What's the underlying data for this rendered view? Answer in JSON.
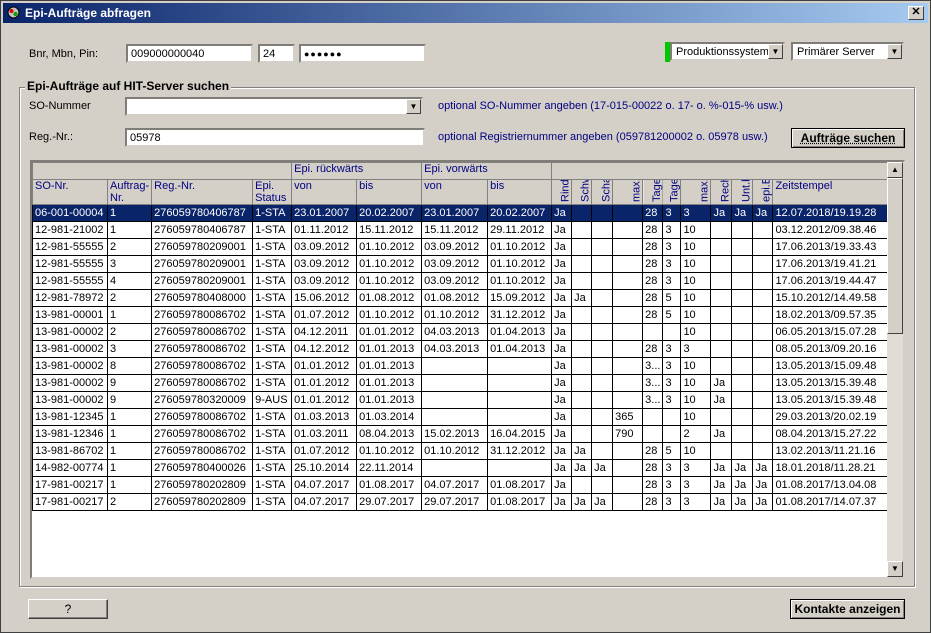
{
  "window": {
    "title": "Epi-Aufträge abfragen",
    "close_glyph": "✕"
  },
  "login": {
    "label": "Bnr, Mbn, Pin:",
    "bnr": "009000000040",
    "mbn": "24",
    "pin": "●●●●●●"
  },
  "system_select": {
    "value": "Produktionssystem"
  },
  "server_select": {
    "value": "Primärer Server"
  },
  "search_group": {
    "title": "Epi-Aufträge auf HIT-Server suchen",
    "so_label": "SO-Nummer",
    "so_value": "",
    "so_hint": "optional SO-Nummer angeben (17-015-00022 o. 17- o. %-015-% usw.)",
    "reg_label": "Reg.-Nr.:",
    "reg_value": "05978",
    "reg_hint": "optional Registriernummer angeben (059781200002 o. 05978 usw.)",
    "search_button": "Aufträge suchen"
  },
  "table": {
    "group_headers": {
      "epi_rueck": "Epi. rückwärts",
      "epi_vor": "Epi. vorwärts"
    },
    "columns": {
      "so_nr": "SO-Nr.",
      "auftrag_nr": "Auftrag-Nr.",
      "reg_nr": "Reg.-Nr.",
      "epi_status": "Epi. Status",
      "rueck_von": "von",
      "rueck_bis": "bis",
      "vor_von": "von",
      "vor_bis": "bis",
      "rind": "Rind",
      "schwein": "Schwein",
      "schaf": "Schaf/Ziege",
      "max_zeitraum": "max. Zeitraum",
      "tage_halter": "Tage Halter",
      "tage_haendler": "Tage Händler",
      "max_ebene": "max. Ebene",
      "rechne": "Rechne ind. Kont.",
      "unt_bez": "Unt.beziehungen",
      "epi_bez": "epi.Beziehungen",
      "zeitstempel": "Zeitstempel"
    },
    "rows": [
      [
        "06-001-00004",
        "1",
        "276059780406787",
        "1-STA",
        "23.01.2007",
        "20.02.2007",
        "23.01.2007",
        "20.02.2007",
        "Ja",
        "",
        "",
        "",
        "28",
        "3",
        "3",
        "Ja",
        "Ja",
        "Ja",
        "12.07.2018/19.19.28"
      ],
      [
        "12-981-21002",
        "1",
        "276059780406787",
        "1-STA",
        "01.11.2012",
        "15.11.2012",
        "15.11.2012",
        "29.11.2012",
        "Ja",
        "",
        "",
        "",
        "28",
        "3",
        "10",
        "",
        "",
        "",
        "03.12.2012/09.38.46"
      ],
      [
        "12-981-55555",
        "2",
        "276059780209001",
        "1-STA",
        "03.09.2012",
        "01.10.2012",
        "03.09.2012",
        "01.10.2012",
        "Ja",
        "",
        "",
        "",
        "28",
        "3",
        "10",
        "",
        "",
        "",
        "17.06.2013/19.33.43"
      ],
      [
        "12-981-55555",
        "3",
        "276059780209001",
        "1-STA",
        "03.09.2012",
        "01.10.2012",
        "03.09.2012",
        "01.10.2012",
        "Ja",
        "",
        "",
        "",
        "28",
        "3",
        "10",
        "",
        "",
        "",
        "17.06.2013/19.41.21"
      ],
      [
        "12-981-55555",
        "4",
        "276059780209001",
        "1-STA",
        "03.09.2012",
        "01.10.2012",
        "03.09.2012",
        "01.10.2012",
        "Ja",
        "",
        "",
        "",
        "28",
        "3",
        "10",
        "",
        "",
        "",
        "17.06.2013/19.44.47"
      ],
      [
        "12-981-78972",
        "2",
        "276059780408000",
        "1-STA",
        "15.06.2012",
        "01.08.2012",
        "01.08.2012",
        "15.09.2012",
        "Ja",
        "Ja",
        "",
        "",
        "28",
        "5",
        "10",
        "",
        "",
        "",
        "15.10.2012/14.49.58"
      ],
      [
        "13-981-00001",
        "1",
        "276059780086702",
        "1-STA",
        "01.07.2012",
        "01.10.2012",
        "01.10.2012",
        "31.12.2012",
        "Ja",
        "",
        "",
        "",
        "28",
        "5",
        "10",
        "",
        "",
        "",
        "18.02.2013/09.57.35"
      ],
      [
        "13-981-00002",
        "2",
        "276059780086702",
        "1-STA",
        "04.12.2011",
        "01.01.2012",
        "04.03.2013",
        "01.04.2013",
        "Ja",
        "",
        "",
        "",
        "",
        "",
        "10",
        "",
        "",
        "",
        "06.05.2013/15.07.28"
      ],
      [
        "13-981-00002",
        "3",
        "276059780086702",
        "1-STA",
        "04.12.2012",
        "01.01.2013",
        "04.03.2013",
        "01.04.2013",
        "Ja",
        "",
        "",
        "",
        "28",
        "3",
        "3",
        "",
        "",
        "",
        "08.05.2013/09.20.16"
      ],
      [
        "13-981-00002",
        "8",
        "276059780086702",
        "1-STA",
        "01.01.2012",
        "01.01.2013",
        "",
        "",
        "Ja",
        "",
        "",
        "",
        "3...",
        "3",
        "10",
        "",
        "",
        "",
        "13.05.2013/15.09.48"
      ],
      [
        "13-981-00002",
        "9",
        "276059780086702",
        "1-STA",
        "01.01.2012",
        "01.01.2013",
        "",
        "",
        "Ja",
        "",
        "",
        "",
        "3...",
        "3",
        "10",
        "Ja",
        "",
        "",
        "13.05.2013/15.39.48"
      ],
      [
        "13-981-00002",
        "9",
        "276059780320009",
        "9-AUS",
        "01.01.2012",
        "01.01.2013",
        "",
        "",
        "Ja",
        "",
        "",
        "",
        "3...",
        "3",
        "10",
        "Ja",
        "",
        "",
        "13.05.2013/15.39.48"
      ],
      [
        "13-981-12345",
        "1",
        "276059780086702",
        "1-STA",
        "01.03.2013",
        "01.03.2014",
        "",
        "",
        "Ja",
        "",
        "",
        "365",
        "",
        "",
        "10",
        "",
        "",
        "",
        "29.03.2013/20.02.19"
      ],
      [
        "13-981-12346",
        "1",
        "276059780086702",
        "1-STA",
        "01.03.2011",
        "08.04.2013",
        "15.02.2013",
        "16.04.2015",
        "Ja",
        "",
        "",
        "790",
        "",
        "",
        "2",
        "Ja",
        "",
        "",
        "08.04.2013/15.27.22"
      ],
      [
        "13-981-86702",
        "1",
        "276059780086702",
        "1-STA",
        "01.07.2012",
        "01.10.2012",
        "01.10.2012",
        "31.12.2012",
        "Ja",
        "Ja",
        "",
        "",
        "28",
        "5",
        "10",
        "",
        "",
        "",
        "13.02.2013/11.21.16"
      ],
      [
        "14-982-00774",
        "1",
        "276059780400026",
        "1-STA",
        "25.10.2014",
        "22.11.2014",
        "",
        "",
        "Ja",
        "Ja",
        "Ja",
        "",
        "28",
        "3",
        "3",
        "Ja",
        "Ja",
        "Ja",
        "18.01.2018/11.28.21"
      ],
      [
        "17-981-00217",
        "1",
        "276059780202809",
        "1-STA",
        "04.07.2017",
        "01.08.2017",
        "04.07.2017",
        "01.08.2017",
        "Ja",
        "",
        "",
        "",
        "28",
        "3",
        "3",
        "Ja",
        "Ja",
        "Ja",
        "01.08.2017/13.04.08"
      ],
      [
        "17-981-00217",
        "2",
        "276059780202809",
        "1-STA",
        "04.07.2017",
        "29.07.2017",
        "29.07.2017",
        "01.08.2017",
        "Ja",
        "Ja",
        "Ja",
        "",
        "28",
        "3",
        "3",
        "Ja",
        "Ja",
        "Ja",
        "01.08.2017/14.07.37"
      ]
    ]
  },
  "footer": {
    "help_button": "?",
    "contacts_button": "Kontakte anzeigen"
  },
  "colors": {
    "selection": "#0a246a",
    "header_text": "#000080",
    "indicator": "#00c800"
  },
  "icons": {
    "app": "app-icon",
    "dropdown": "dropdown-arrow-icon",
    "scroll_up": "scroll-up-icon",
    "scroll_down": "scroll-down-icon"
  }
}
